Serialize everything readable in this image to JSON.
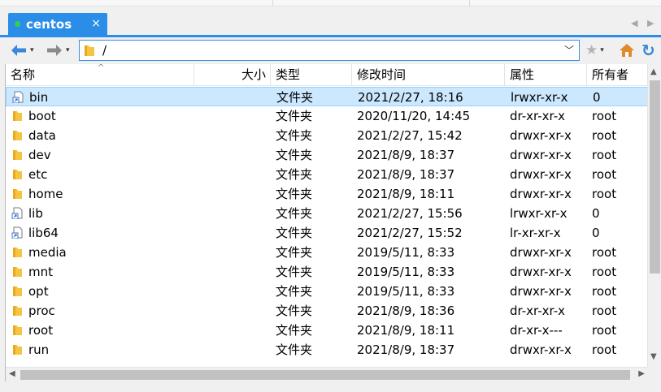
{
  "tab": {
    "title": "centos",
    "close": "×",
    "status_color": "#31d24a"
  },
  "tabbar_nav": {
    "left": "◀",
    "right": "▶"
  },
  "toolbar": {
    "back": "🡐",
    "back_caret": "▾",
    "forward": "🡒",
    "forward_caret": "▾",
    "path": "/",
    "path_dropdown": "﹀",
    "bookmark": "★",
    "bookmark_caret": "▾",
    "home": "⌂",
    "refresh": "↻"
  },
  "columns": {
    "name": "名称",
    "size": "大小",
    "type": "类型",
    "modified": "修改时间",
    "attributes": "属性",
    "owner": "所有者"
  },
  "sort_indicator": "^",
  "files": [
    {
      "name": "bin",
      "size": "",
      "type": "文件夹",
      "modified": "2021/2/27, 18:16",
      "attributes": "lrwxr-xr-x",
      "owner": "0",
      "icon": "link-icon",
      "selected": true
    },
    {
      "name": "boot",
      "size": "",
      "type": "文件夹",
      "modified": "2020/11/20, 14:45",
      "attributes": "dr-xr-xr-x",
      "owner": "root",
      "icon": "folder-icon"
    },
    {
      "name": "data",
      "size": "",
      "type": "文件夹",
      "modified": "2021/2/27, 15:42",
      "attributes": "drwxr-xr-x",
      "owner": "root",
      "icon": "folder-icon"
    },
    {
      "name": "dev",
      "size": "",
      "type": "文件夹",
      "modified": "2021/8/9, 18:37",
      "attributes": "drwxr-xr-x",
      "owner": "root",
      "icon": "folder-icon"
    },
    {
      "name": "etc",
      "size": "",
      "type": "文件夹",
      "modified": "2021/8/9, 18:37",
      "attributes": "drwxr-xr-x",
      "owner": "root",
      "icon": "folder-icon"
    },
    {
      "name": "home",
      "size": "",
      "type": "文件夹",
      "modified": "2021/8/9, 18:11",
      "attributes": "drwxr-xr-x",
      "owner": "root",
      "icon": "folder-icon"
    },
    {
      "name": "lib",
      "size": "",
      "type": "文件夹",
      "modified": "2021/2/27, 15:56",
      "attributes": "lrwxr-xr-x",
      "owner": "0",
      "icon": "link-icon"
    },
    {
      "name": "lib64",
      "size": "",
      "type": "文件夹",
      "modified": "2021/2/27, 15:52",
      "attributes": "lr-xr-xr-x",
      "owner": "0",
      "icon": "link-icon"
    },
    {
      "name": "media",
      "size": "",
      "type": "文件夹",
      "modified": "2019/5/11, 8:33",
      "attributes": "drwxr-xr-x",
      "owner": "root",
      "icon": "folder-icon"
    },
    {
      "name": "mnt",
      "size": "",
      "type": "文件夹",
      "modified": "2019/5/11, 8:33",
      "attributes": "drwxr-xr-x",
      "owner": "root",
      "icon": "folder-icon"
    },
    {
      "name": "opt",
      "size": "",
      "type": "文件夹",
      "modified": "2019/5/11, 8:33",
      "attributes": "drwxr-xr-x",
      "owner": "root",
      "icon": "folder-icon"
    },
    {
      "name": "proc",
      "size": "",
      "type": "文件夹",
      "modified": "2021/8/9, 18:36",
      "attributes": "dr-xr-xr-x",
      "owner": "root",
      "icon": "folder-icon"
    },
    {
      "name": "root",
      "size": "",
      "type": "文件夹",
      "modified": "2021/8/9, 18:11",
      "attributes": "dr-xr-x---",
      "owner": "root",
      "icon": "folder-icon"
    },
    {
      "name": "run",
      "size": "",
      "type": "文件夹",
      "modified": "2021/8/9, 18:37",
      "attributes": "drwxr-xr-x",
      "owner": "root",
      "icon": "folder-icon"
    }
  ],
  "colors": {
    "accent": "#2a8ee8",
    "selection": "#cce8ff",
    "folder": "#f5c542"
  }
}
